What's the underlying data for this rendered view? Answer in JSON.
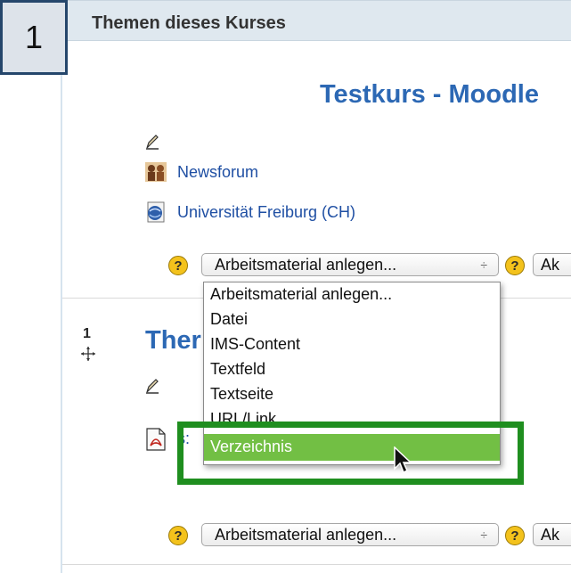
{
  "step_badge": "1",
  "header": {
    "title": "Themen dieses Kurses"
  },
  "section0": {
    "title": "Testkurs - Moodle",
    "activities": [
      {
        "icon": "forum-icon",
        "label": "Newsforum"
      },
      {
        "icon": "url-globe-icon",
        "label": "Universität Freiburg (CH)"
      }
    ],
    "add_resource": {
      "selected": "Arbeitsmaterial anlegen...",
      "arrows": "÷",
      "partial_select": "Ak"
    }
  },
  "dropdown": {
    "options": [
      "Arbeitsmaterial anlegen...",
      "Datei",
      "IMS-Content",
      "Textfeld",
      "Textseite",
      "URL/Link"
    ],
    "highlighted": "Verzeichnis"
  },
  "section1": {
    "number": "1",
    "title": "Ther",
    "activity_partial": "s:",
    "add_resource": {
      "selected": "Arbeitsmaterial anlegen...",
      "arrows": "÷",
      "partial_select": "Ak"
    }
  },
  "colors": {
    "accent_blue": "#2c68b4",
    "highlight_green": "#72bf44",
    "focus_frame": "#1f8e1f",
    "header_bg": "#dfe8ef"
  }
}
